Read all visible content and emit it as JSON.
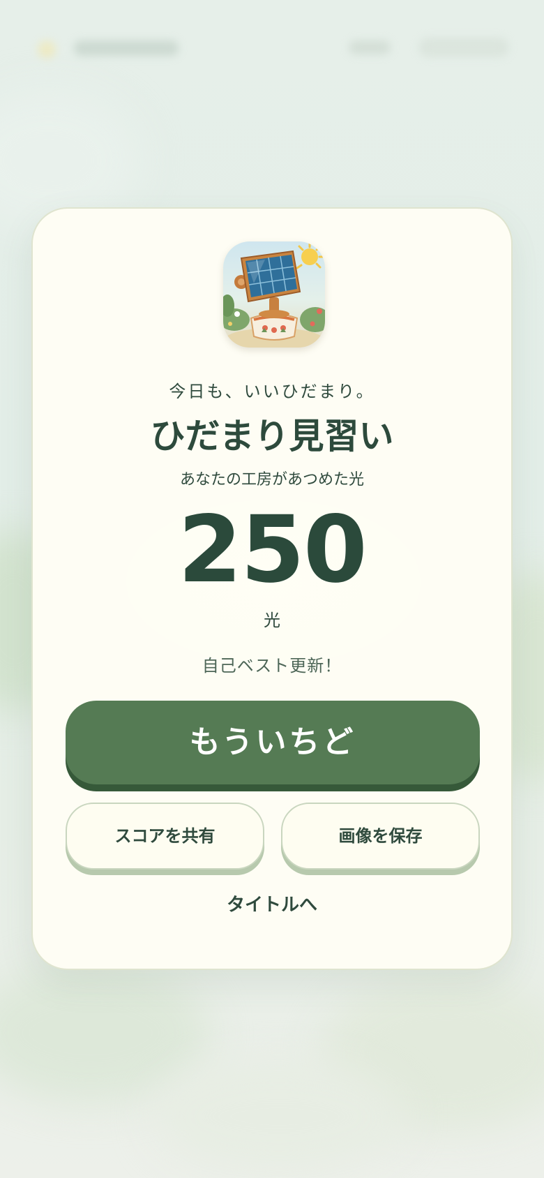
{
  "background": {
    "colors": {
      "base": "#e4eee8",
      "leaf": "#cfe0c8",
      "sun": "#f4e7a8"
    }
  },
  "result_card": {
    "app_icon": "solar-panel-icon",
    "eyebrow": "今日も、いいひだまり。",
    "rank_title": "ひだまり見習い",
    "caption": "あなたの工房があつめた光",
    "score": "250",
    "score_unit": "光",
    "best_message": "自己ベスト更新！",
    "buttons": {
      "retry": "もういちど",
      "share": "スコアを共有",
      "save": "画像を保存",
      "to_title": "タイトルへ"
    }
  },
  "colors": {
    "card_bg": "#fefdf4",
    "primary": "#557b54",
    "primary_shadow": "#365939",
    "text": "#2d4a3c"
  }
}
